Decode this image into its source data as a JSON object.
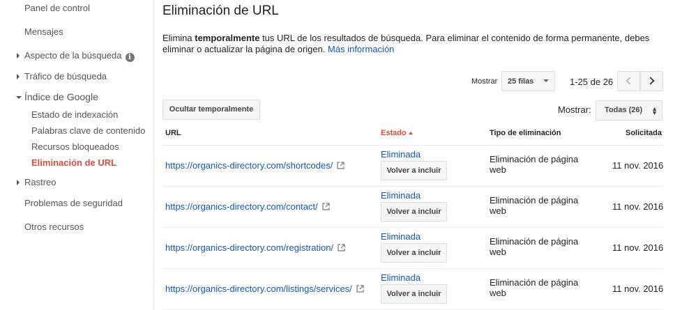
{
  "sidebar": {
    "panel": "Panel de control",
    "messages": "Mensajes",
    "search_appearance": "Aspecto de la búsqueda",
    "search_traffic": "Tráfico de búsqueda",
    "google_index": "Índice de Google",
    "index_items": [
      {
        "label": "Estado de indexación"
      },
      {
        "label": "Palabras clave de contenido"
      },
      {
        "label": "Recursos bloqueados"
      },
      {
        "label": "Eliminación de URL"
      }
    ],
    "crawl": "Rastreo",
    "security": "Problemas de seguridad",
    "other": "Otros recursos"
  },
  "main": {
    "title": "Eliminación de URL",
    "desc_pre": "Elimina ",
    "desc_bold": "temporalmente",
    "desc_post": " tus URL de los resultados de búsqueda. Para eliminar el contenido de forma permanente, debes eliminar o actualizar la página de origen. ",
    "more_info": "Más información",
    "show_label": "Mostrar",
    "rows_select": "25 filas",
    "range": "1-25 de 26",
    "hide_button": "Ocultar temporalmente",
    "filter_label": "Mostrar:",
    "filter_value": "Todas (26)",
    "columns": {
      "url": "URL",
      "status": "Estado",
      "type": "Tipo de eliminación",
      "requested": "Solicitada"
    },
    "rows": [
      {
        "url": "https://organics-directory.com/shortcodes/",
        "status": "Eliminada",
        "action": "Volver a incluir",
        "type": "Eliminación de página web",
        "date": "11 nov. 2016"
      },
      {
        "url": "https://organics-directory.com/contact/",
        "status": "Eliminada",
        "action": "Volver a incluir",
        "type": "Eliminación de página web",
        "date": "11 nov. 2016"
      },
      {
        "url": "https://organics-directory.com/registration/",
        "status": "Eliminada",
        "action": "Volver a incluir",
        "type": "Eliminación de página web",
        "date": "11 nov. 2016"
      },
      {
        "url": "https://organics-directory.com/listings/services/",
        "status": "Eliminada",
        "action": "Volver a incluir",
        "type": "Eliminación de página web",
        "date": "11 nov. 2016"
      }
    ]
  },
  "colors": {
    "accent_red": "#dd4b39",
    "link_blue": "#1155cc"
  }
}
